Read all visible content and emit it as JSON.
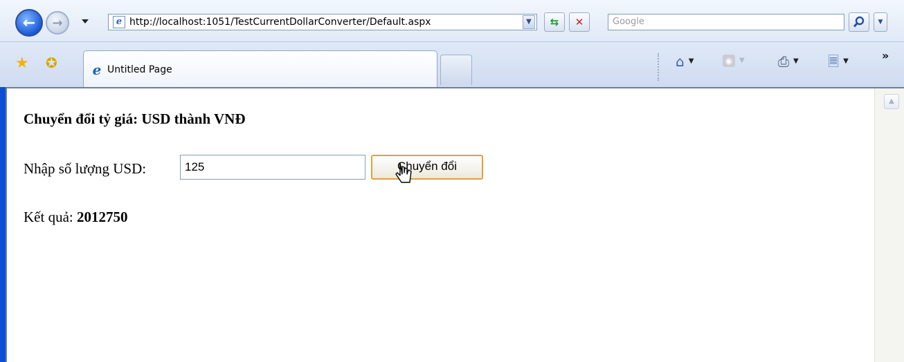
{
  "browser": {
    "address": "http://localhost:1051/TestCurrentDollarConverter/Default.aspx",
    "search_placeholder": "Google",
    "tab_title": "Untitled Page",
    "icons": [
      "back-icon",
      "forward-icon",
      "refresh-icon",
      "stop-icon",
      "search-icon",
      "favorites-star-icon",
      "add-favorites-icon",
      "home-icon",
      "feeds-icon",
      "print-icon",
      "page-icon"
    ]
  },
  "page": {
    "heading": "Chuyển đổi tỷ giá: USD thành VNĐ",
    "input_label": "Nhập số lượng USD:",
    "input_value": "125",
    "button_label": "Chuyển đổi",
    "result_label": "Kết quả:",
    "result_value": "2012750"
  },
  "colors": {
    "window_frame": "#0b4fd6",
    "button_focus_border": "#e0a13a"
  }
}
